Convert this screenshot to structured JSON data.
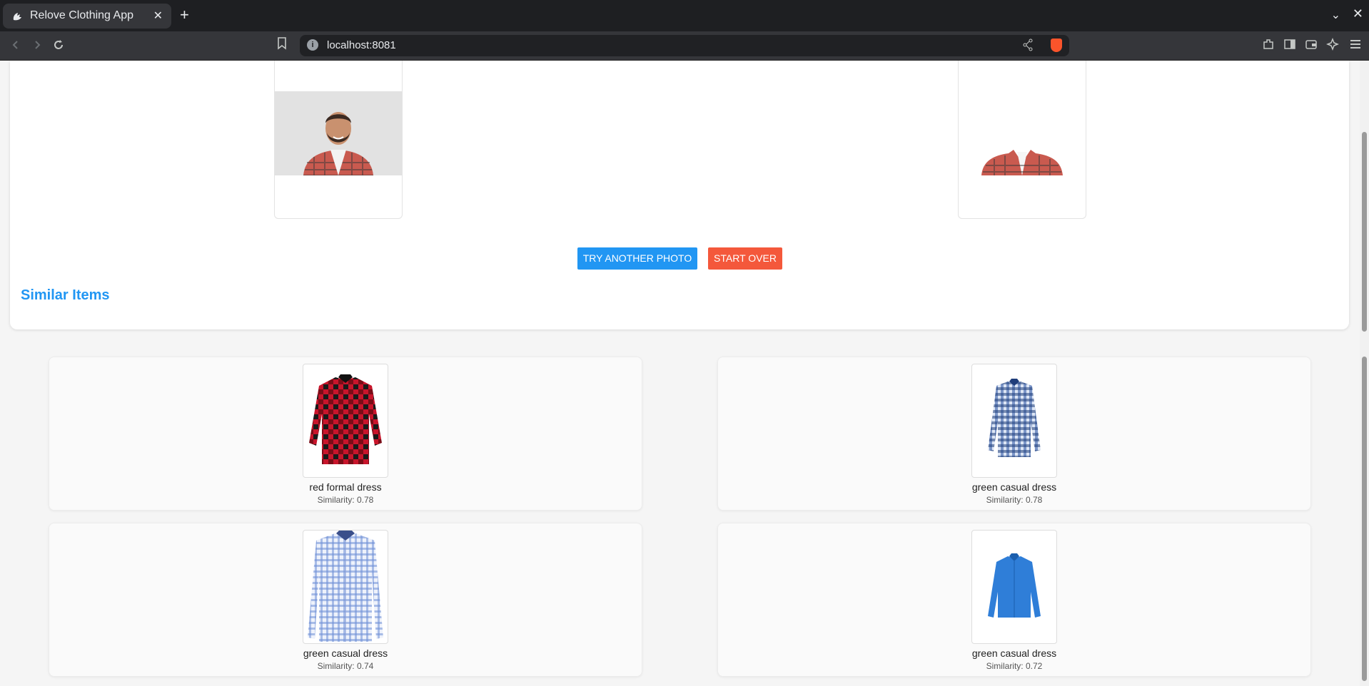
{
  "browser": {
    "tab_title": "Relove Clothing App",
    "url": "localhost:8081",
    "close_glyph": "✕",
    "new_tab_glyph": "+",
    "tab_menu_glyph": "⌄",
    "window_close_glyph": "✕"
  },
  "actions": {
    "try_another_label": "TRY ANOTHER PHOTO",
    "start_over_label": "START OVER",
    "try_color": "#2196f3",
    "start_over_color": "#f4583b"
  },
  "similar": {
    "title": "Similar Items",
    "items": [
      {
        "name": "red formal dress",
        "similarity": "Similarity: 0.78"
      },
      {
        "name": "green casual dress",
        "similarity": "Similarity: 0.78"
      },
      {
        "name": "green casual dress",
        "similarity": "Similarity: 0.74"
      },
      {
        "name": "green casual dress",
        "similarity": "Similarity: 0.72"
      }
    ]
  },
  "icons": [
    "back-icon",
    "forward-icon",
    "reload-icon",
    "bookmark-icon",
    "site-info-icon",
    "share-icon",
    "brave-shield-icon",
    "extensions-icon",
    "sidebar-icon",
    "wallet-icon",
    "leo-ai-icon",
    "menu-icon"
  ]
}
